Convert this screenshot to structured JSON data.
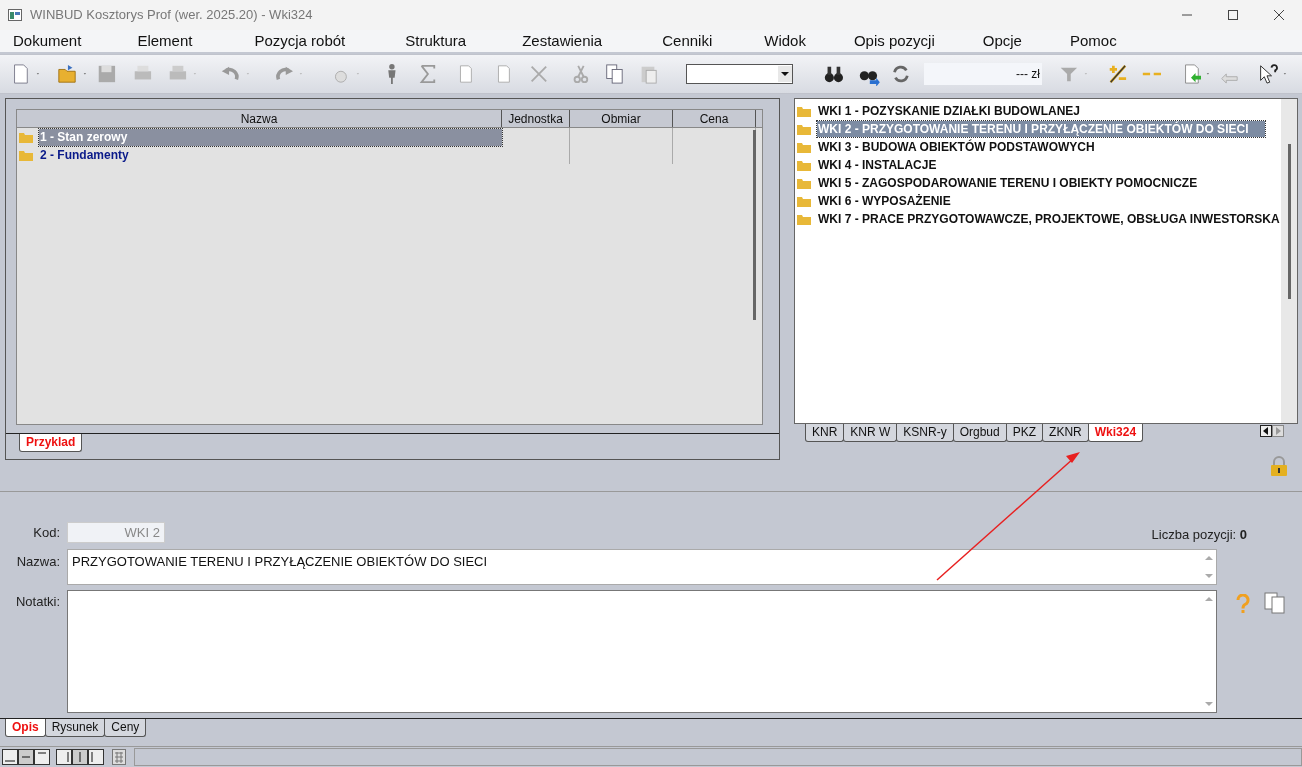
{
  "window": {
    "title": "WINBUD Kosztorys Prof (wer. 2025.20) - Wki324"
  },
  "menu": [
    "Dokument",
    "Element",
    "Pozycja robót",
    "Struktura",
    "Zestawienia",
    "Cenniki",
    "Widok",
    "Opis pozycji",
    "Opcje",
    "Pomoc"
  ],
  "toolbar": {
    "price_field": "--- zł"
  },
  "structure_table": {
    "columns": [
      "Nazwa",
      "Jednostka",
      "Obmiar",
      "Cena"
    ],
    "rows": [
      {
        "name": "1 - Stan zerowy",
        "selected": true
      },
      {
        "name": "2 - Fundamenty",
        "selected": false
      }
    ]
  },
  "structure_tabs": [
    {
      "label": "Przyklad",
      "selected": true
    }
  ],
  "catalog_list": [
    {
      "label": "WKI 1 - POZYSKANIE DZIAŁKI BUDOWLANEJ",
      "selected": false
    },
    {
      "label": "WKI 2 - PRZYGOTOWANIE TERENU I PRZYŁĄCZENIE OBIEKTÓW DO SIECI",
      "selected": true
    },
    {
      "label": "WKI 3 - BUDOWA OBIEKTÓW PODSTAWOWYCH",
      "selected": false
    },
    {
      "label": "WKI 4 - INSTALACJE",
      "selected": false
    },
    {
      "label": "WKI 5 - ZAGOSPODAROWANIE TERENU I OBIEKTY POMOCNICZE",
      "selected": false
    },
    {
      "label": "WKI 6 - WYPOSAŻENIE",
      "selected": false
    },
    {
      "label": "WKI 7 - PRACE PRZYGOTOWAWCZE, PROJEKTOWE, OBSŁUGA INWESTORSKA",
      "selected": false
    }
  ],
  "catalog_tabs": [
    {
      "label": "KNR",
      "selected": false
    },
    {
      "label": "KNR W",
      "selected": false
    },
    {
      "label": "KSNR-y",
      "selected": false
    },
    {
      "label": "Orgbud",
      "selected": false
    },
    {
      "label": "PKZ",
      "selected": false
    },
    {
      "label": "ZKNR",
      "selected": false
    },
    {
      "label": "Wki324",
      "selected": true
    }
  ],
  "details": {
    "kod_label": "Kod:",
    "kod_value": "WKI 2",
    "count_label": "Liczba pozycji:",
    "count_value": "0",
    "nazwa_label": "Nazwa:",
    "nazwa_value": "PRZYGOTOWANIE TERENU I PRZYŁĄCZENIE OBIEKTÓW DO SIECI",
    "notatki_label": "Notatki:"
  },
  "bottom_tabs": [
    {
      "label": "Opis",
      "selected": true
    },
    {
      "label": "Rysunek",
      "selected": false
    },
    {
      "label": "Ceny",
      "selected": false
    }
  ]
}
